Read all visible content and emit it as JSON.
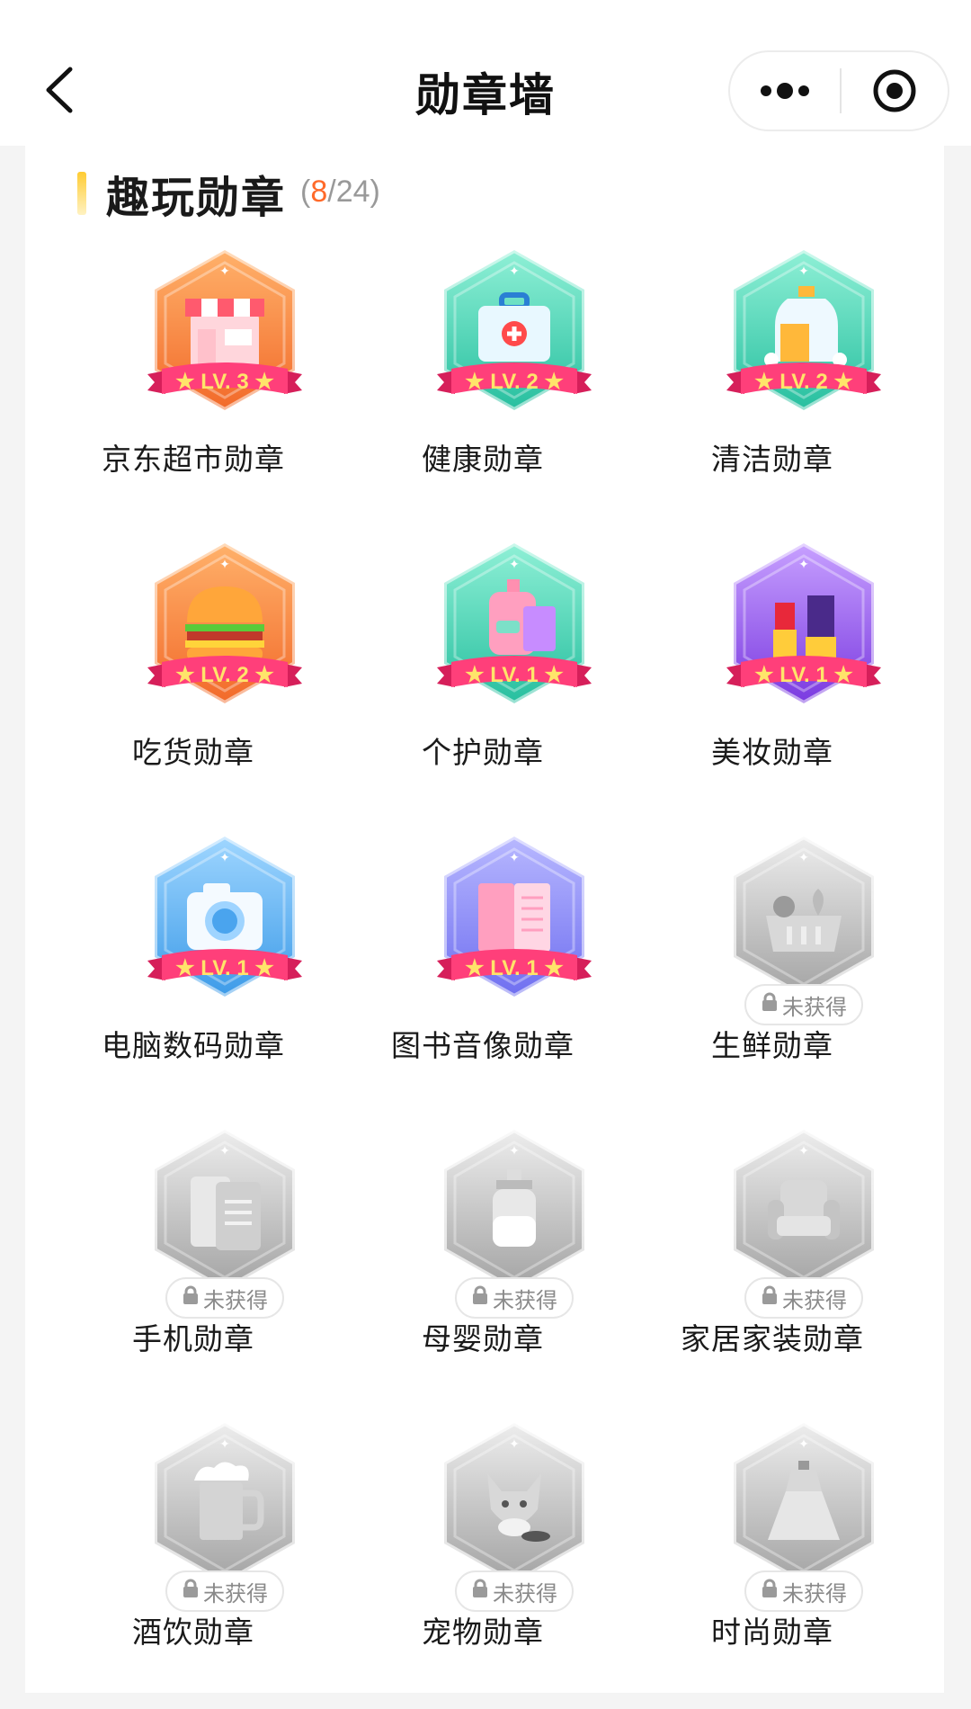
{
  "nav": {
    "title": "勋章墙",
    "back_icon": "chevron-left-icon",
    "more_icon": "more-dots-icon",
    "close_icon": "target-close-icon"
  },
  "section": {
    "title": "趣玩勋章",
    "obtained": "8",
    "total": "/24",
    "open_paren": "(",
    "close_paren": ")",
    "accent_color": "#ff6a2a"
  },
  "colors": {
    "orange": "#f3742e",
    "teal": "#33c8a8",
    "purple": "#8a4ce0",
    "blue": "#4aa4ee",
    "indigo": "#7f7ef0",
    "ribbon": "#ff3f7a",
    "gray": "#a8a8a8"
  },
  "badges": [
    {
      "name": "京东超市勋章",
      "level": "LV. 3",
      "icon": "storefront-icon",
      "color": "orange",
      "earned": true
    },
    {
      "name": "健康勋章",
      "level": "LV. 2",
      "icon": "first-aid-kit-icon",
      "color": "teal",
      "earned": true
    },
    {
      "name": "清洁勋章",
      "level": "LV. 2",
      "icon": "detergent-bottle-icon",
      "color": "teal",
      "earned": true
    },
    {
      "name": "吃货勋章",
      "level": "LV. 2",
      "icon": "burger-icon",
      "color": "orange",
      "earned": true
    },
    {
      "name": "个护勋章",
      "level": "LV. 1",
      "icon": "lotion-bottle-icon",
      "color": "teal",
      "earned": true
    },
    {
      "name": "美妆勋章",
      "level": "LV. 1",
      "icon": "lipstick-icon",
      "color": "purple",
      "earned": true
    },
    {
      "name": "电脑数码勋章",
      "level": "LV. 1",
      "icon": "camera-icon",
      "color": "blue",
      "earned": true
    },
    {
      "name": "图书音像勋章",
      "level": "LV. 1",
      "icon": "open-book-icon",
      "color": "indigo",
      "earned": true
    },
    {
      "name": "生鲜勋章",
      "locked": "未获得",
      "icon": "produce-basket-icon",
      "color": "gray",
      "earned": false
    },
    {
      "name": "手机勋章",
      "locked": "未获得",
      "icon": "phones-icon",
      "color": "gray",
      "earned": false
    },
    {
      "name": "母婴勋章",
      "locked": "未获得",
      "icon": "baby-bottle-icon",
      "color": "gray",
      "earned": false
    },
    {
      "name": "家居家装勋章",
      "locked": "未获得",
      "icon": "armchair-icon",
      "color": "gray",
      "earned": false
    },
    {
      "name": "酒饮勋章",
      "locked": "未获得",
      "icon": "beer-mug-icon",
      "color": "gray",
      "earned": false
    },
    {
      "name": "宠物勋章",
      "locked": "未获得",
      "icon": "corgi-dog-icon",
      "color": "gray",
      "earned": false
    },
    {
      "name": "时尚勋章",
      "locked": "未获得",
      "icon": "dress-icon",
      "color": "gray",
      "earned": false
    }
  ]
}
